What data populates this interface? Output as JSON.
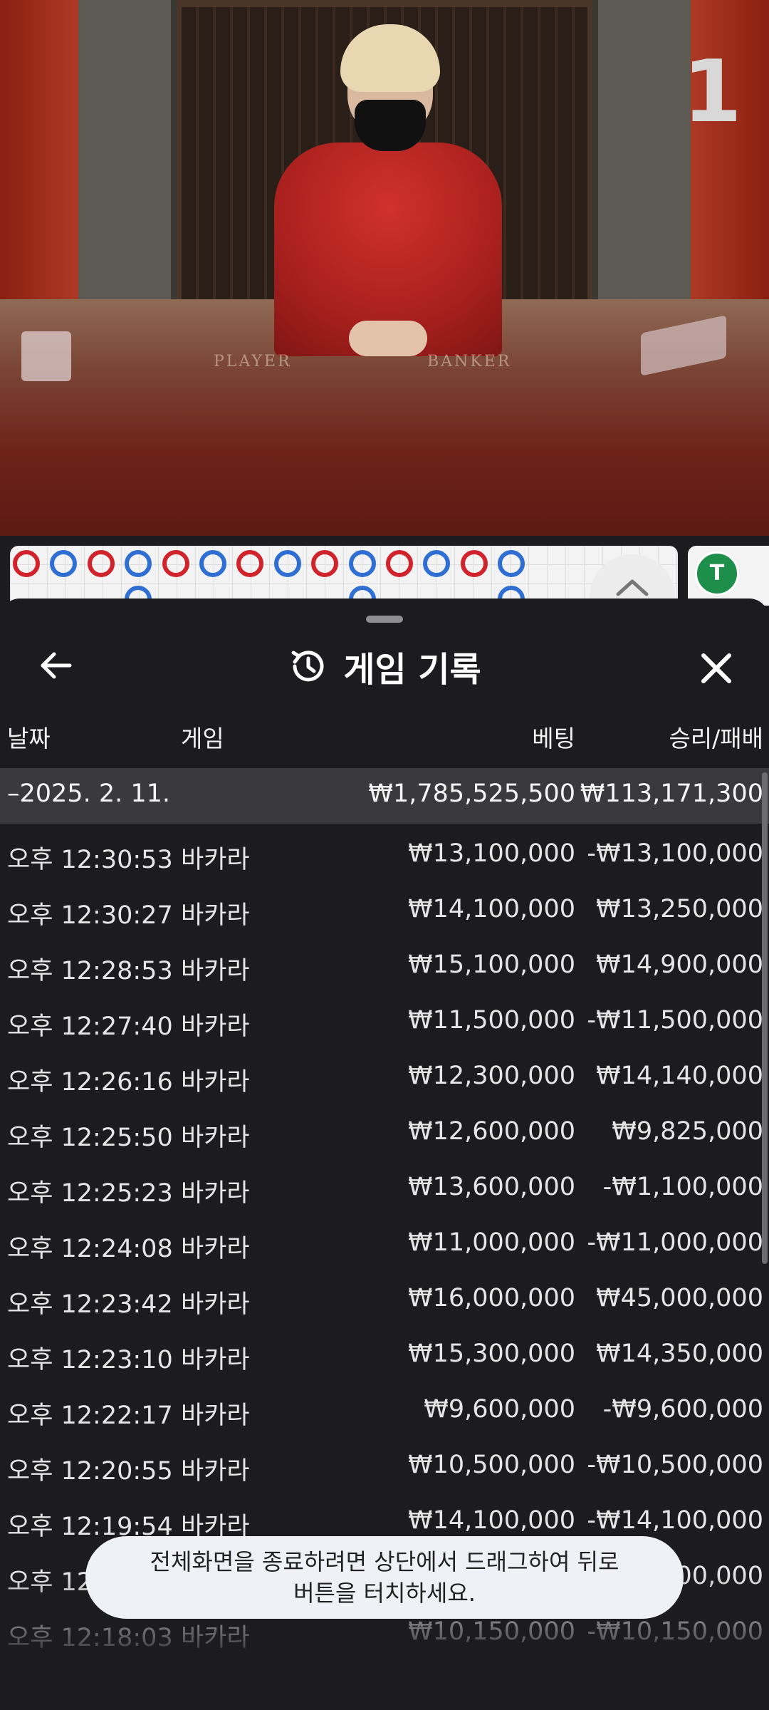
{
  "video": {
    "table_number": "1",
    "player_label": "PLAYER",
    "banker_label": "BANKER"
  },
  "roadmap": {
    "top_row": [
      "B",
      "P",
      "B",
      "P",
      "B",
      "P",
      "B",
      "P",
      "B",
      "P",
      "B",
      "P",
      "B",
      "P"
    ],
    "second_row_marks": [
      3,
      9,
      13
    ],
    "tie_badge": "T",
    "colors": {
      "banker": "#d0232c",
      "player": "#2f6fd4",
      "tie": "#1e8f4a"
    }
  },
  "panel": {
    "back_icon": "arrow-left-icon",
    "history_icon": "history-icon",
    "title": "게임 기록",
    "close_icon": "close-icon",
    "columns": {
      "date": "날짜",
      "game": "게임",
      "bet": "베팅",
      "win_loss": "승리/패배"
    },
    "summary": {
      "date": "–2025. 2. 11.",
      "bet": "₩1,785,525,500",
      "win_loss": "₩113,171,300"
    },
    "rows": [
      {
        "time": "오후 12:30:53",
        "game": "바카라",
        "bet": "₩13,100,000",
        "win_loss": "-₩13,100,000"
      },
      {
        "time": "오후 12:30:27",
        "game": "바카라",
        "bet": "₩14,100,000",
        "win_loss": "₩13,250,000"
      },
      {
        "time": "오후 12:28:53",
        "game": "바카라",
        "bet": "₩15,100,000",
        "win_loss": "₩14,900,000"
      },
      {
        "time": "오후 12:27:40",
        "game": "바카라",
        "bet": "₩11,500,000",
        "win_loss": "-₩11,500,000"
      },
      {
        "time": "오후 12:26:16",
        "game": "바카라",
        "bet": "₩12,300,000",
        "win_loss": "₩14,140,000"
      },
      {
        "time": "오후 12:25:50",
        "game": "바카라",
        "bet": "₩12,600,000",
        "win_loss": "₩9,825,000"
      },
      {
        "time": "오후 12:25:23",
        "game": "바카라",
        "bet": "₩13,600,000",
        "win_loss": "-₩1,100,000"
      },
      {
        "time": "오후 12:24:08",
        "game": "바카라",
        "bet": "₩11,000,000",
        "win_loss": "-₩11,000,000"
      },
      {
        "time": "오후 12:23:42",
        "game": "바카라",
        "bet": "₩16,000,000",
        "win_loss": "₩45,000,000"
      },
      {
        "time": "오후 12:23:10",
        "game": "바카라",
        "bet": "₩15,300,000",
        "win_loss": "₩14,350,000"
      },
      {
        "time": "오후 12:22:17",
        "game": "바카라",
        "bet": "₩9,600,000",
        "win_loss": "-₩9,600,000"
      },
      {
        "time": "오후 12:20:55",
        "game": "바카라",
        "bet": "₩10,500,000",
        "win_loss": "-₩10,500,000"
      },
      {
        "time": "오후 12:19:54",
        "game": "바카라",
        "bet": "₩14,100,000",
        "win_loss": "-₩14,100,000"
      },
      {
        "time": "오후 12",
        "game": "",
        "bet": "",
        "win_loss": "00,000"
      },
      {
        "time": "오후 12:18:03",
        "game": "바카라",
        "bet": "₩10,150,000",
        "win_loss": "-₩10,150,000"
      }
    ]
  },
  "toast": {
    "line1": "전체화면을 종료하려면 상단에서 드래그하여 뒤로",
    "line2": "버튼을 터치하세요."
  }
}
